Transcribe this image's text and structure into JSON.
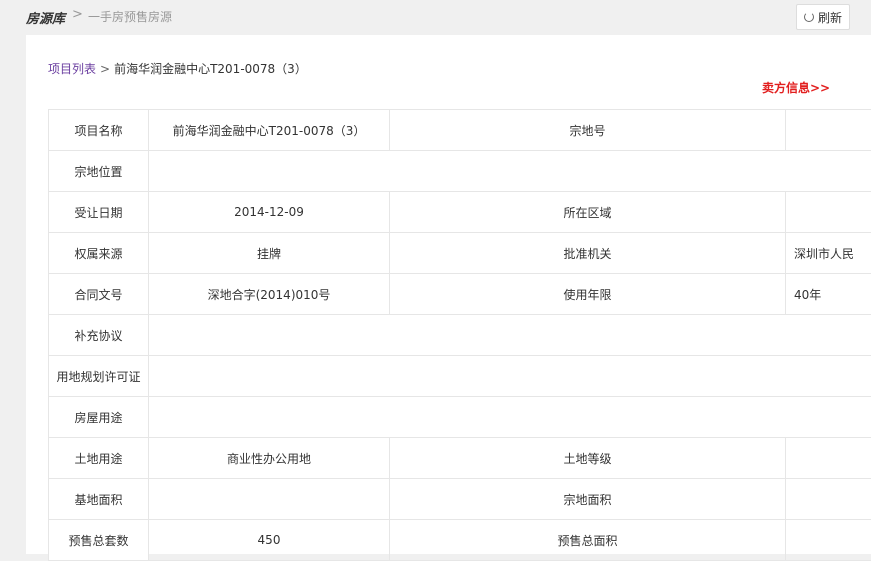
{
  "header": {
    "brand": "房源库",
    "separator": ">",
    "current": "一手房预售房源",
    "refresh_label": "刷新"
  },
  "breadcrumb": {
    "list_link": "项目列表",
    "arrow": ">",
    "current": "前海华润金融中心T201-0078（3）"
  },
  "seller_link": "卖方信息>>",
  "table": {
    "project_name_label": "项目名称",
    "project_name": "前海华润金融中心T201-0078（3）",
    "parcel_no_label": "宗地号",
    "parcel_no": "",
    "parcel_location_label": "宗地位置",
    "parcel_location": "",
    "transfer_date_label": "受让日期",
    "transfer_date": "2014-12-09",
    "district_label": "所在区域",
    "district": "",
    "ownership_source_label": "权属来源",
    "ownership_source": "挂牌",
    "approval_authority_label": "批准机关",
    "approval_authority": "深圳市人民",
    "contract_no_label": "合同文号",
    "contract_no": "深地合字(2014)010号",
    "use_period_label": "使用年限",
    "use_period": "40年",
    "supplement_label": "补充协议",
    "supplement": "",
    "land_permit_label": "用地规划许可证",
    "land_permit": "",
    "house_usage_label": "房屋用途",
    "house_usage": "",
    "land_usage_label": "土地用途",
    "land_usage": "商业性办公用地",
    "land_grade_label": "土地等级",
    "land_grade": "",
    "base_area_label": "基地面积",
    "base_area": "",
    "parcel_area_label": "宗地面积",
    "parcel_area": "",
    "presale_units_label": "预售总套数",
    "presale_units": "450",
    "presale_area_label": "预售总面积",
    "presale_area": ""
  }
}
